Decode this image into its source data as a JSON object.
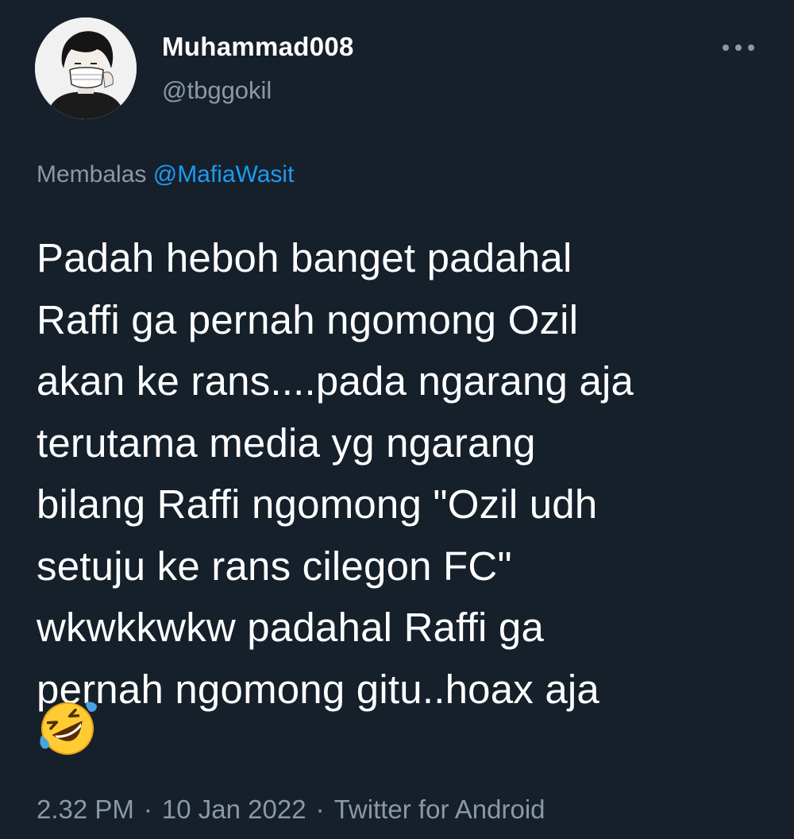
{
  "user": {
    "display_name": "Muhammad008",
    "handle": "@tbggokil",
    "avatar_icon": "user-avatar"
  },
  "menu": {
    "icon": "more-options-icon"
  },
  "reply": {
    "prefix": "Membalas",
    "mention": "@MafiaWasit"
  },
  "tweet": {
    "text": "Padah heboh banget padahal\nRaffi ga pernah ngomong Ozil\nakan ke rans....pada ngarang aja\nterutama media yg ngarang\nbilang Raffi ngomong \"Ozil udh\nsetuju ke rans cilegon FC\"\nwkwkkwkw padahal Raffi ga\npernah ngomong gitu..hoax aja",
    "emoji": "rolling-on-the-floor-laughing-emoji"
  },
  "meta": {
    "time": "2.32 PM",
    "date": "10 Jan 2022",
    "source": "Twitter for Android",
    "separator": "·"
  },
  "colors": {
    "background": "#15202b",
    "text_primary": "#ffffff",
    "text_secondary": "#8b98a5",
    "accent": "#1d9bf0"
  }
}
